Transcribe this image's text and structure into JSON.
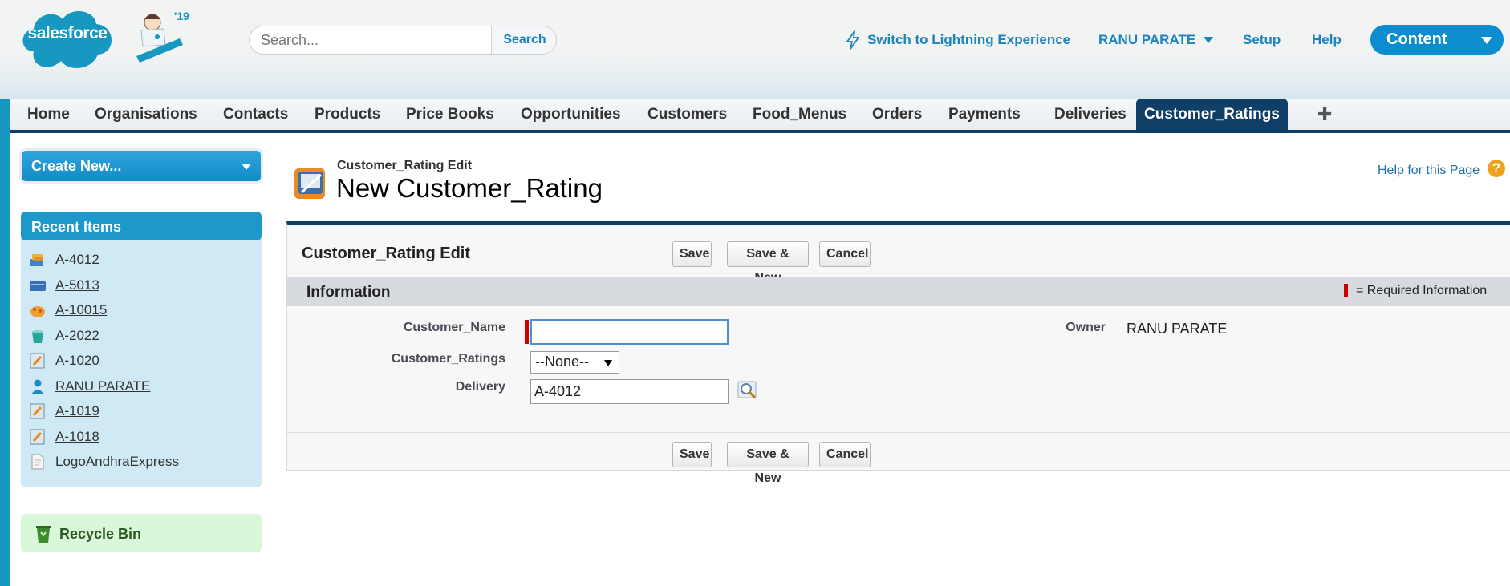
{
  "header": {
    "logo_text": "salesforce",
    "release_badge": "'19",
    "search": {
      "placeholder": "Search...",
      "value": "",
      "button_label": "Search"
    },
    "lightning_link": "Switch to Lightning Experience",
    "user_menu": "RANU PARATE",
    "setup_link": "Setup",
    "help_link": "Help",
    "app_switcher": "Content"
  },
  "tabs": [
    {
      "label": "Home"
    },
    {
      "label": "Organisations"
    },
    {
      "label": "Contacts"
    },
    {
      "label": "Products"
    },
    {
      "label": "Price Books"
    },
    {
      "label": "Opportunities"
    },
    {
      "label": "Customers"
    },
    {
      "label": "Food_Menus"
    },
    {
      "label": "Orders"
    },
    {
      "label": "Payments"
    },
    {
      "label": "Deliveries"
    },
    {
      "label": "Customer_Ratings",
      "active": true
    }
  ],
  "tab_plus": "✚",
  "sidebar": {
    "create_new": "Create New...",
    "recent_title": "Recent Items",
    "recent_items": [
      {
        "label": "A-4012",
        "icon": "delivery-icon"
      },
      {
        "label": "A-5013",
        "icon": "payment-icon"
      },
      {
        "label": "A-10015",
        "icon": "order-icon"
      },
      {
        "label": "A-2022",
        "icon": "food-menu-icon"
      },
      {
        "label": "A-1020",
        "icon": "rating-icon"
      },
      {
        "label": "RANU PARATE",
        "icon": "user-icon"
      },
      {
        "label": "A-1019",
        "icon": "rating-icon"
      },
      {
        "label": "A-1018",
        "icon": "rating-icon"
      },
      {
        "label": "LogoAndhraExpress",
        "icon": "document-icon"
      }
    ],
    "recycle_bin": "Recycle Bin"
  },
  "page": {
    "eyebrow": "Customer_Rating Edit",
    "title": "New Customer_Rating",
    "help": "Help for this Page",
    "help_symbol": "?"
  },
  "edit_block": {
    "title": "Customer_Rating Edit",
    "buttons": {
      "save": "Save",
      "save_new": "Save & New",
      "cancel": "Cancel"
    },
    "section_title": "Information",
    "required_legend": "= Required Information",
    "fields": {
      "customer_name_label": "Customer_Name",
      "customer_name_value": "",
      "customer_ratings_label": "Customer_Ratings",
      "customer_ratings_value": "--None--",
      "delivery_label": "Delivery",
      "delivery_value": "A-4012",
      "owner_label": "Owner",
      "owner_value": "RANU PARATE"
    }
  },
  "colors": {
    "brand_blue": "#1b84bf",
    "tab_active": "#0f3f66",
    "required_red": "#cc0000",
    "recent_panel": "#cfeaf5",
    "recycle_panel": "#d9f7d9"
  }
}
